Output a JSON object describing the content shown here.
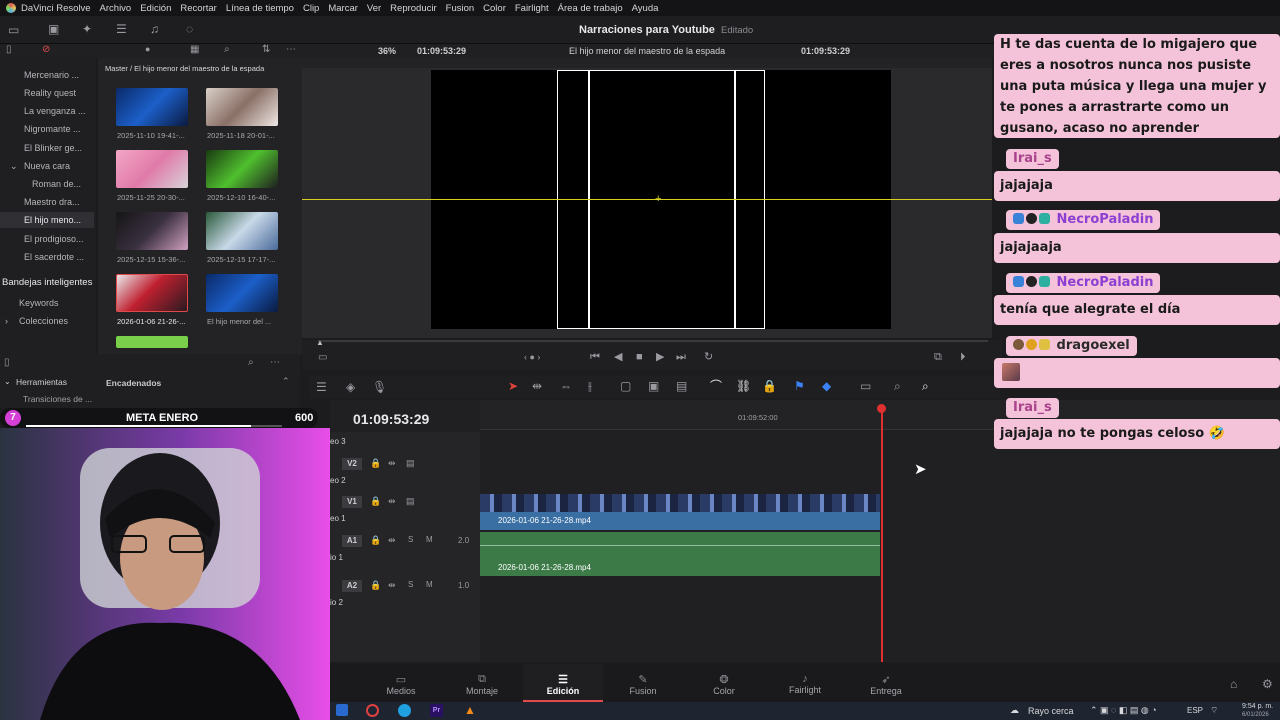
{
  "menubar": {
    "items": [
      "DaVinci Resolve",
      "Archivo",
      "Edición",
      "Recortar",
      "Línea de tiempo",
      "Clip",
      "Marcar",
      "Ver",
      "Reproducir",
      "Fusion",
      "Color",
      "Fairlight",
      "Área de trabajo",
      "Ayuda"
    ]
  },
  "toolbar": {
    "project_title": "Narraciones para Youtube",
    "status": "Editado"
  },
  "subbar": {
    "zoom": "36%",
    "timecode_left": "01:09:53:29",
    "timeline_name": "El hijo menor del maestro de la espada",
    "timecode_right": "01:09:53:29"
  },
  "mediapool": {
    "breadcrumb": "Master / El hijo menor del maestro de la espada",
    "bins": [
      "Mercenario ...",
      "Reality quest",
      "La venganza ...",
      "Nigromante ...",
      "El Blinker ge...",
      "Nueva cara",
      "Roman de...",
      "Maestro dra...",
      "El hijo meno...",
      "El prodigioso...",
      "El sacerdote ..."
    ],
    "smart_bins_title": "Bandejas inteligentes",
    "smart_bins": [
      "Keywords",
      "Colecciones"
    ],
    "clips": [
      "2025-11-10 19-41-...",
      "2025-11-18 20-01-...",
      "2025-11-25 20-30-...",
      "2025-12-10 16-40-...",
      "2025-12-15 15-36-...",
      "2025-12-15 17-17-...",
      "2026-01-06 21-26-...",
      "El hijo menor del ..."
    ]
  },
  "effects": {
    "tools_label": "Herramientas",
    "transitions_label": "Transiciones de ...",
    "transitions2_label": "Transiciones de ...",
    "nested_label": "Encadenados"
  },
  "goal": {
    "count": "7",
    "label": "META ENERO",
    "target": "600",
    "progress": 0.88
  },
  "timeline": {
    "timecode": "01:09:53:29",
    "ruler_mark": "01:09:52:00",
    "tracks": [
      {
        "id": "V2",
        "sub": "eo 2"
      },
      {
        "id": "V1",
        "sub": "eo 1"
      },
      {
        "id": "A1",
        "sub": "io 1",
        "vol": "2.0"
      },
      {
        "id": "A2",
        "sub": "io 2",
        "vol": "1.0"
      }
    ],
    "track_top_label": "eo 3",
    "video_clip": "2026-01-06 21-26-28.mp4",
    "audio_clip": "2026-01-06 21-26-28.mp4"
  },
  "pages": [
    "Medios",
    "Montaje",
    "Edición",
    "Fusion",
    "Color",
    "Fairlight",
    "Entrega"
  ],
  "taskbar": {
    "weather": "Rayo cerca",
    "lang": "ESP",
    "time": "9:54 p. m.",
    "date": "6/01/2026"
  },
  "chat": [
    {
      "user": "",
      "text": "H te das cuenta de lo migajero que eres a nosotros nunca nos pusiste una puta música y llega una mujer y te pones a arrastrarte como un gusano, acaso no aprender"
    },
    {
      "user": "Irai_s",
      "text": "jajajaja"
    },
    {
      "user": "NecroPaladin",
      "text": "jajajaaja"
    },
    {
      "user": "NecroPaladin",
      "text": "tenía que alegrate el día"
    },
    {
      "user": "dragoexel",
      "text": ""
    },
    {
      "user": "Irai_s",
      "text": "jajajaja no te pongas celoso 🤣"
    }
  ],
  "colors": {
    "accent": "#e04a4a",
    "chat_bg": "#f4c3d9",
    "video_clip": "#3a6fa3",
    "audio_clip": "#3c7a48",
    "playhead": "#e0302f"
  }
}
